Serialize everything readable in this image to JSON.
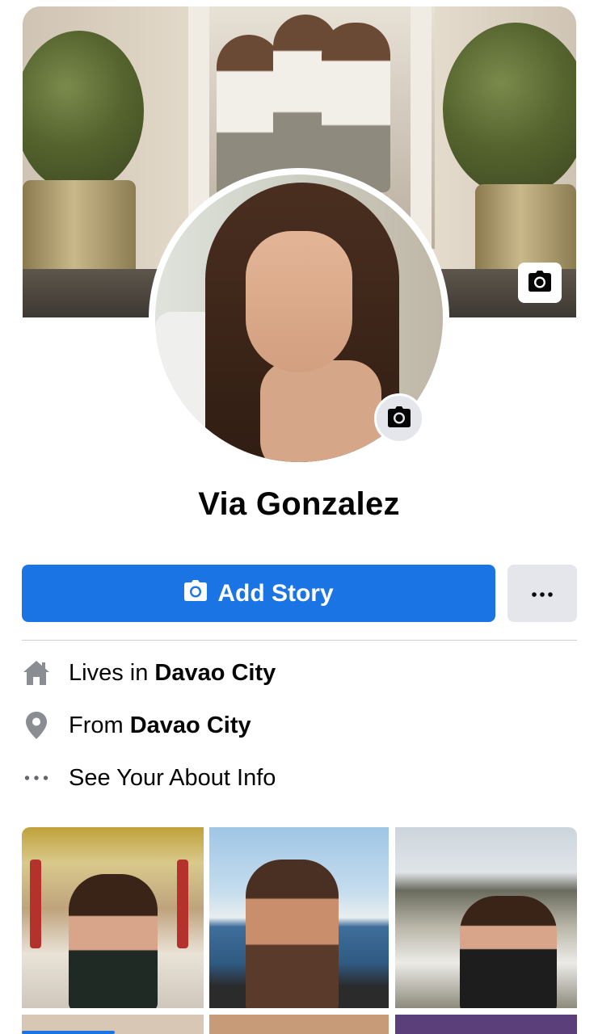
{
  "profile": {
    "name": "Via Gonzalez"
  },
  "actions": {
    "add_story_label": "Add Story",
    "more_label": "•••"
  },
  "info": {
    "lives_prefix": "Lives in ",
    "lives_city": "Davao City",
    "from_prefix": "From ",
    "from_city": "Davao City",
    "about_label": "See Your About Info"
  },
  "icons": {
    "cover_camera": "camera-icon",
    "avatar_camera": "camera-icon",
    "add_story": "camera-icon",
    "more": "more-horizontal-icon",
    "lives": "home-icon",
    "from": "location-pin-icon",
    "about": "more-horizontal-icon"
  },
  "colors": {
    "accent": "#1b74e4",
    "secondary_button": "#e4e6eb",
    "icon_gray": "#8a8d91"
  }
}
